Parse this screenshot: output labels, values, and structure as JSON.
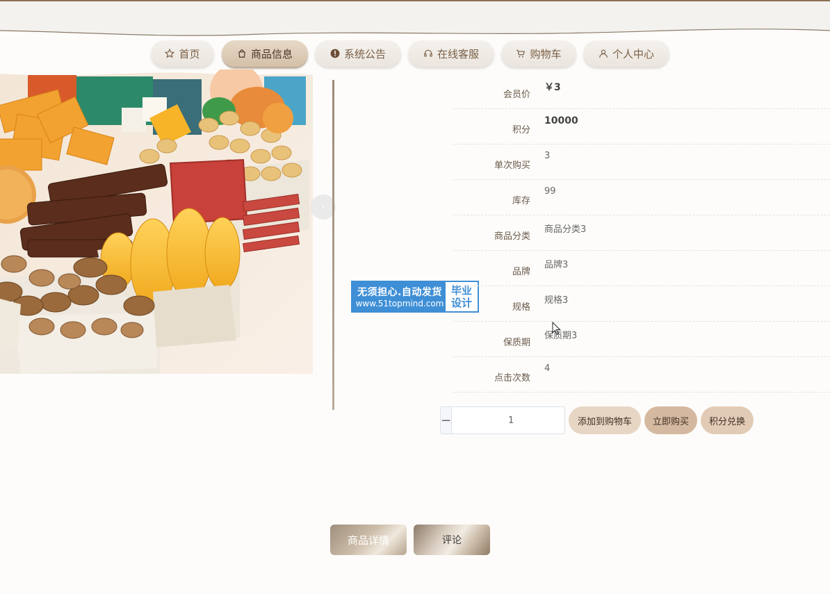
{
  "nav": {
    "items": [
      {
        "label": "首页",
        "icon": "star-icon",
        "active": false
      },
      {
        "label": "商品信息",
        "icon": "shopping-bag-icon",
        "active": true
      },
      {
        "label": "系统公告",
        "icon": "warning-icon",
        "active": false
      },
      {
        "label": "在线客服",
        "icon": "headset-icon",
        "active": false
      },
      {
        "label": "购物车",
        "icon": "cart-icon",
        "active": false
      },
      {
        "label": "个人中心",
        "icon": "user-icon",
        "active": false
      }
    ]
  },
  "watermark": {
    "line1": "无须担心.自动发货",
    "line2": "www.51topmind.com",
    "badge_line1": "毕业",
    "badge_line2": "设计"
  },
  "details": [
    {
      "label": "会员价",
      "value": "￥3"
    },
    {
      "label": "积分",
      "value": "10000"
    },
    {
      "label": "单次购买",
      "value": "3"
    },
    {
      "label": "库存",
      "value": "99"
    },
    {
      "label": "商品分类",
      "value": "商品分类3"
    },
    {
      "label": "品牌",
      "value": "品牌3"
    },
    {
      "label": "规格",
      "value": "规格3"
    },
    {
      "label": "保质期",
      "value": "保质期3"
    },
    {
      "label": "点击次数",
      "value": "4"
    }
  ],
  "quantity": {
    "value": "1",
    "minus": "−",
    "plus": "+"
  },
  "actions": {
    "add_to_cart": "添加到购物车",
    "buy_now": "立即购买",
    "points_redeem": "积分兑换"
  },
  "tabs": {
    "detail": "商品详情",
    "comment": "评论"
  },
  "colors": {
    "accent": "#d4b9a0",
    "nav_text": "#7a5f45",
    "watermark_blue": "#3f8fd6"
  }
}
